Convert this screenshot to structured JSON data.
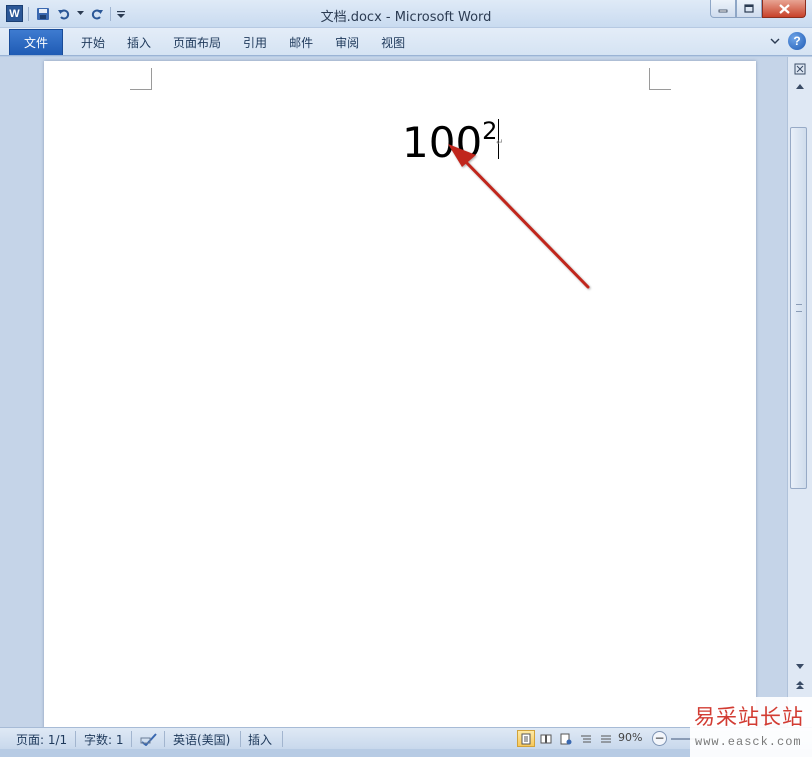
{
  "window": {
    "title": "文档.docx  -  Microsoft Word",
    "app_logo": "W"
  },
  "quick_access": {
    "icons": [
      "word-logo-icon",
      "save-icon",
      "undo-icon",
      "undo-dropdown-icon",
      "redo-icon",
      "customize-qat-icon"
    ]
  },
  "ribbon": {
    "file_tab": "文件",
    "tabs": [
      "开始",
      "插入",
      "页面布局",
      "引用",
      "邮件",
      "审阅",
      "视图"
    ],
    "help_label": "?"
  },
  "document": {
    "base_text": "100",
    "superscript_text": "2",
    "paragraph_mark": "↵"
  },
  "status_bar": {
    "page": "页面: 1/1",
    "words": "字数: 1",
    "language": "英语(美国)",
    "insert_mode": "插入",
    "zoom": "90%"
  },
  "watermark": {
    "title": "易采站长站",
    "url": "www.easck.com"
  },
  "colors": {
    "file_tab": "#1f5bb4",
    "annotation_arrow": "#c0281f",
    "watermark_red": "#d23c33"
  }
}
